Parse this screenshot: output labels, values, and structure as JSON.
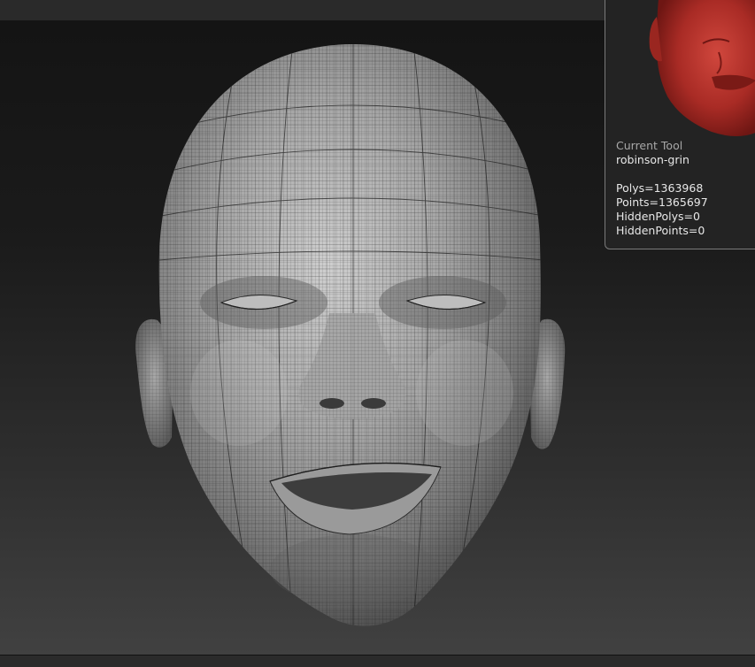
{
  "info_panel": {
    "heading": "Current Tool",
    "tool_name": "robinson-grin",
    "stats": {
      "polys": "Polys=1363968",
      "points": "Points=1365697",
      "hidden_polys": "HiddenPolys=0",
      "hidden_points": "HiddenPoints=0"
    },
    "thumbnail_color": "#b3302a"
  },
  "colors": {
    "viewport_top": "#141414",
    "viewport_bottom": "#414141",
    "mesh_base": "#8c8c8c",
    "wire": "#222222"
  },
  "icons": {
    "model": "sculpted-head-mesh",
    "thumbnail": "tool-thumbnail-red-head"
  }
}
